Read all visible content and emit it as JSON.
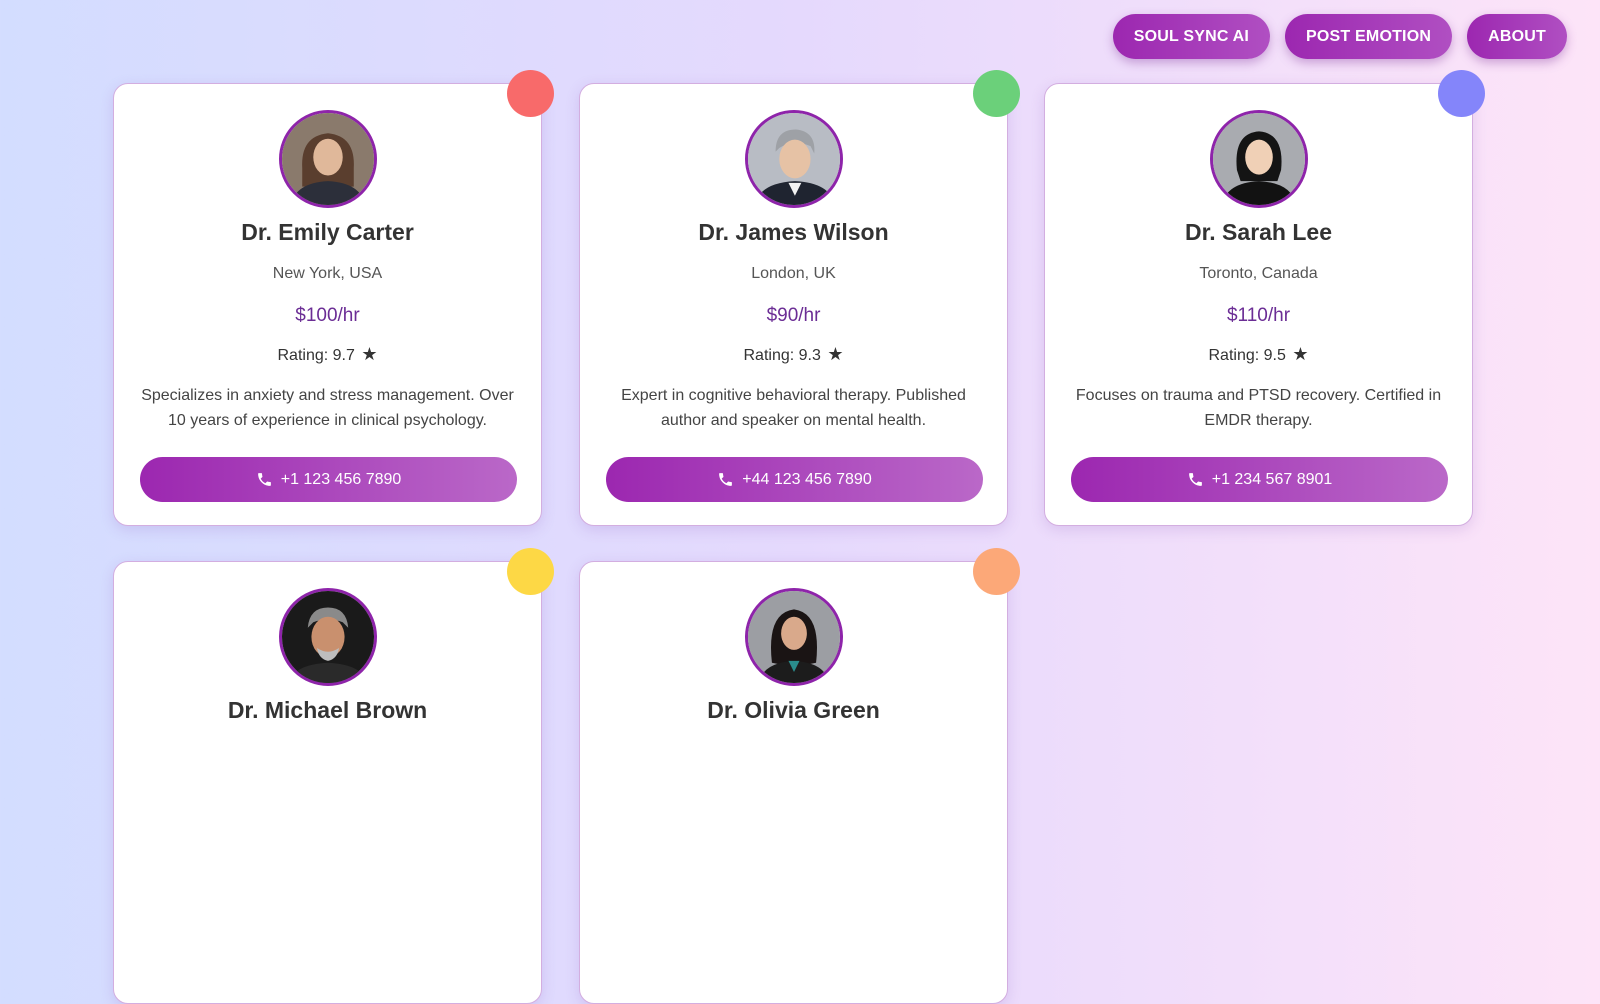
{
  "nav": {
    "items": [
      {
        "label": "SOUL SYNC AI"
      },
      {
        "label": "POST EMOTION"
      },
      {
        "label": "ABOUT"
      }
    ]
  },
  "doctors": [
    {
      "name": "Dr. Emily Carter",
      "location": "New York, USA",
      "price": "$100/hr",
      "rating_label": "Rating: 9.7",
      "rating": 9.7,
      "description": "Specializes in anxiety and stress management. Over 10 years of experience in clinical psychology.",
      "phone": "+1 123 456 7890",
      "accent_color": "#f86a6a"
    },
    {
      "name": "Dr. James Wilson",
      "location": "London, UK",
      "price": "$90/hr",
      "rating_label": "Rating: 9.3",
      "rating": 9.3,
      "description": "Expert in cognitive behavioral therapy. Published author and speaker on mental health.",
      "phone": "+44 123 456 7890",
      "accent_color": "#6bd07a"
    },
    {
      "name": "Dr. Sarah Lee",
      "location": "Toronto, Canada",
      "price": "$110/hr",
      "rating_label": "Rating: 9.5",
      "rating": 9.5,
      "description": "Focuses on trauma and PTSD recovery. Certified in EMDR therapy.",
      "phone": "+1 234 567 8901",
      "accent_color": "#8485fa"
    },
    {
      "name": "Dr. Michael Brown",
      "accent_color": "#fdd845"
    },
    {
      "name": "Dr. Olivia Green",
      "accent_color": "#fca878"
    }
  ],
  "icons": {
    "phone": "phone-icon",
    "star": "star-icon"
  },
  "colors": {
    "primary": "#9c27b0",
    "price_text": "#6b2d95",
    "avatar_border": "#8e24aa"
  }
}
